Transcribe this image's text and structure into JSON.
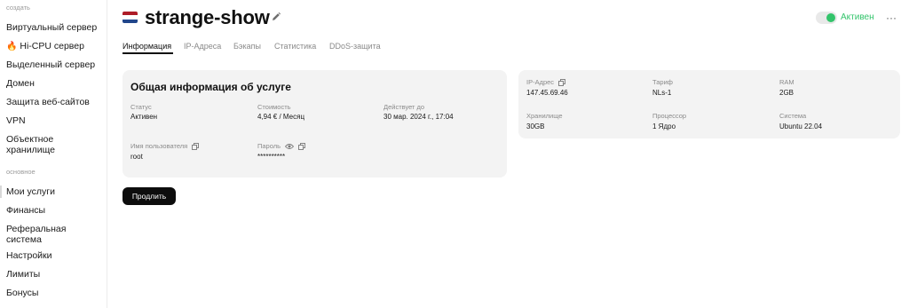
{
  "sidebar": {
    "section_create": "создать",
    "create_items": [
      {
        "label": "Виртуальный сервер"
      },
      {
        "label": "Hi-CPU сервер"
      },
      {
        "label": "Выделенный сервер"
      },
      {
        "label": "Домен"
      },
      {
        "label": "Защита веб-сайтов"
      },
      {
        "label": "VPN"
      },
      {
        "label": "Объектное хранилище"
      }
    ],
    "section_main": "основное",
    "main_items": [
      {
        "label": "Мои услуги"
      },
      {
        "label": "Финансы"
      },
      {
        "label": "Реферальная система"
      },
      {
        "label": "Настройки"
      },
      {
        "label": "Лимиты"
      },
      {
        "label": "Бонусы"
      }
    ]
  },
  "header": {
    "title": "strange-show",
    "status": "Активен",
    "status_color": "#33c46b",
    "flag": "netherlands-flag",
    "more": "···"
  },
  "tabs": [
    {
      "label": "Информация"
    },
    {
      "label": "IP-Адреса"
    },
    {
      "label": "Бэкапы"
    },
    {
      "label": "Статистика"
    },
    {
      "label": "DDoS-защита"
    }
  ],
  "general_card": {
    "title": "Общая информация об услуге",
    "status_label": "Статус",
    "status_value": "Активен",
    "cost_label": "Стоимость",
    "cost_value": "4,94 € / Месяц",
    "valid_label": "Действует до",
    "valid_value": "30 мар. 2024 г., 17:04",
    "user_label": "Имя пользователя",
    "user_value": "root",
    "password_label": "Пароль",
    "password_value": "**********"
  },
  "specs_card": {
    "ip_label": "IP-Адрес",
    "ip_value": "147.45.69.46",
    "tariff_label": "Тариф",
    "tariff_value": "NLs-1",
    "ram_label": "RAM",
    "ram_value": "2GB",
    "storage_label": "Хранилище",
    "storage_value": "30GB",
    "cpu_label": "Процессор",
    "cpu_value": "1 Ядро",
    "os_label": "Система",
    "os_value": "Ubuntu 22.04"
  },
  "renew_button": "Продлить"
}
